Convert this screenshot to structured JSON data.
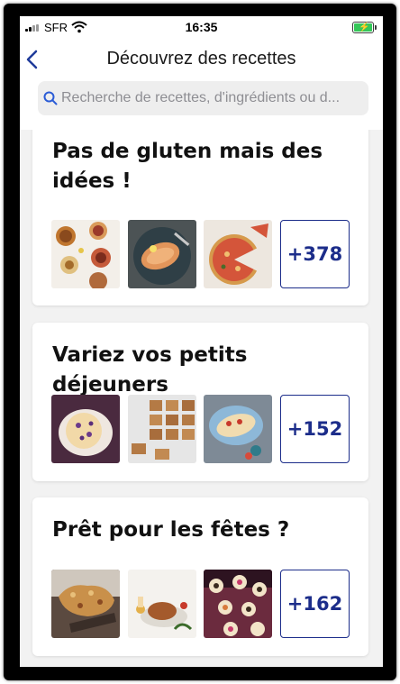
{
  "status_bar": {
    "carrier": "SFR",
    "time": "16:35"
  },
  "nav": {
    "title": "Découvrez des recettes"
  },
  "search": {
    "placeholder": "Recherche de recettes, d'ingrédients ou d..."
  },
  "collections": [
    {
      "title_line1": "Pas de gluten mais des",
      "title_line2": "idées !",
      "more_count": "+378"
    },
    {
      "title_line1": "Variez vos petits déjeuners",
      "more_count": "+152"
    },
    {
      "title_line1": "Prêt pour les fêtes ?",
      "more_count": "+162"
    }
  ],
  "colors": {
    "accent": "#1c2d8a",
    "back_arrow": "#1f3b9a",
    "search_icon": "#2b5cd6",
    "battery": "#35c759",
    "list_background": "#f2f2f2"
  }
}
